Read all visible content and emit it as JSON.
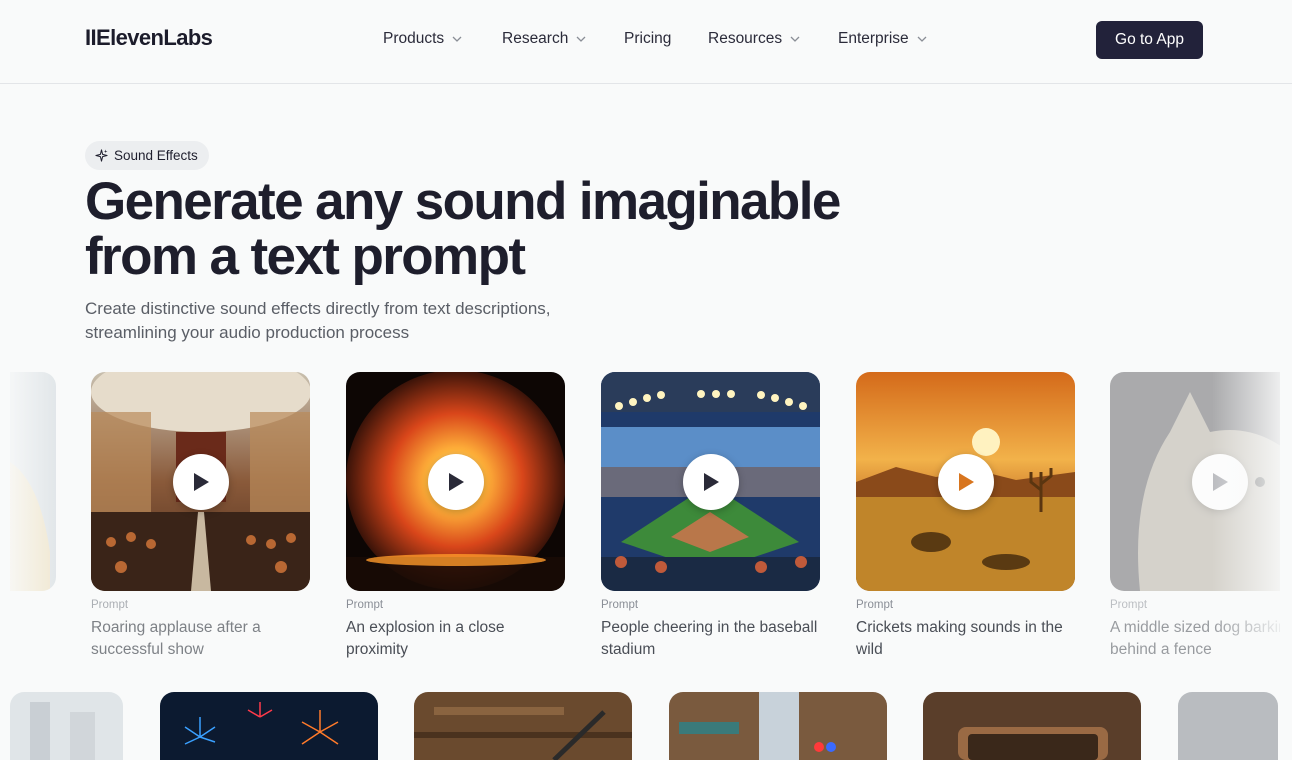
{
  "header": {
    "logo": "IIElevenLabs",
    "nav": [
      {
        "label": "Products",
        "dropdown": true
      },
      {
        "label": "Research",
        "dropdown": true
      },
      {
        "label": "Pricing",
        "dropdown": false
      },
      {
        "label": "Resources",
        "dropdown": true
      },
      {
        "label": "Enterprise",
        "dropdown": true
      }
    ],
    "cta_label": "Go to App"
  },
  "hero": {
    "badge_label": "Sound Effects",
    "badge_icon": "sparkles-icon",
    "title_line1": "Generate any sound imaginable",
    "title_line2": "from a text prompt",
    "subtitle_line1": "Create distinctive sound effects directly from text descriptions,",
    "subtitle_line2": "streamlining your audio production process"
  },
  "cards": [
    {
      "prompt_label": "Prompt",
      "text": "Roaring applause after a successful show",
      "image": "opera-house-audience"
    },
    {
      "prompt_label": "Prompt",
      "text": "An explosion in a close proximity",
      "image": "fiery-explosion"
    },
    {
      "prompt_label": "Prompt",
      "text": "People cheering in the baseball stadium",
      "image": "baseball-stadium"
    },
    {
      "prompt_label": "Prompt",
      "text": "Crickets making sounds in the wild",
      "image": "desert-sunset"
    },
    {
      "prompt_label": "Prompt",
      "text": "A middle sized dog barking behind a fence",
      "image": "dog-portrait"
    }
  ],
  "colors": {
    "background": "#f9fafa",
    "cta_background": "#22223a",
    "title": "#1e1e2c",
    "subtitle": "#5a5e66"
  }
}
